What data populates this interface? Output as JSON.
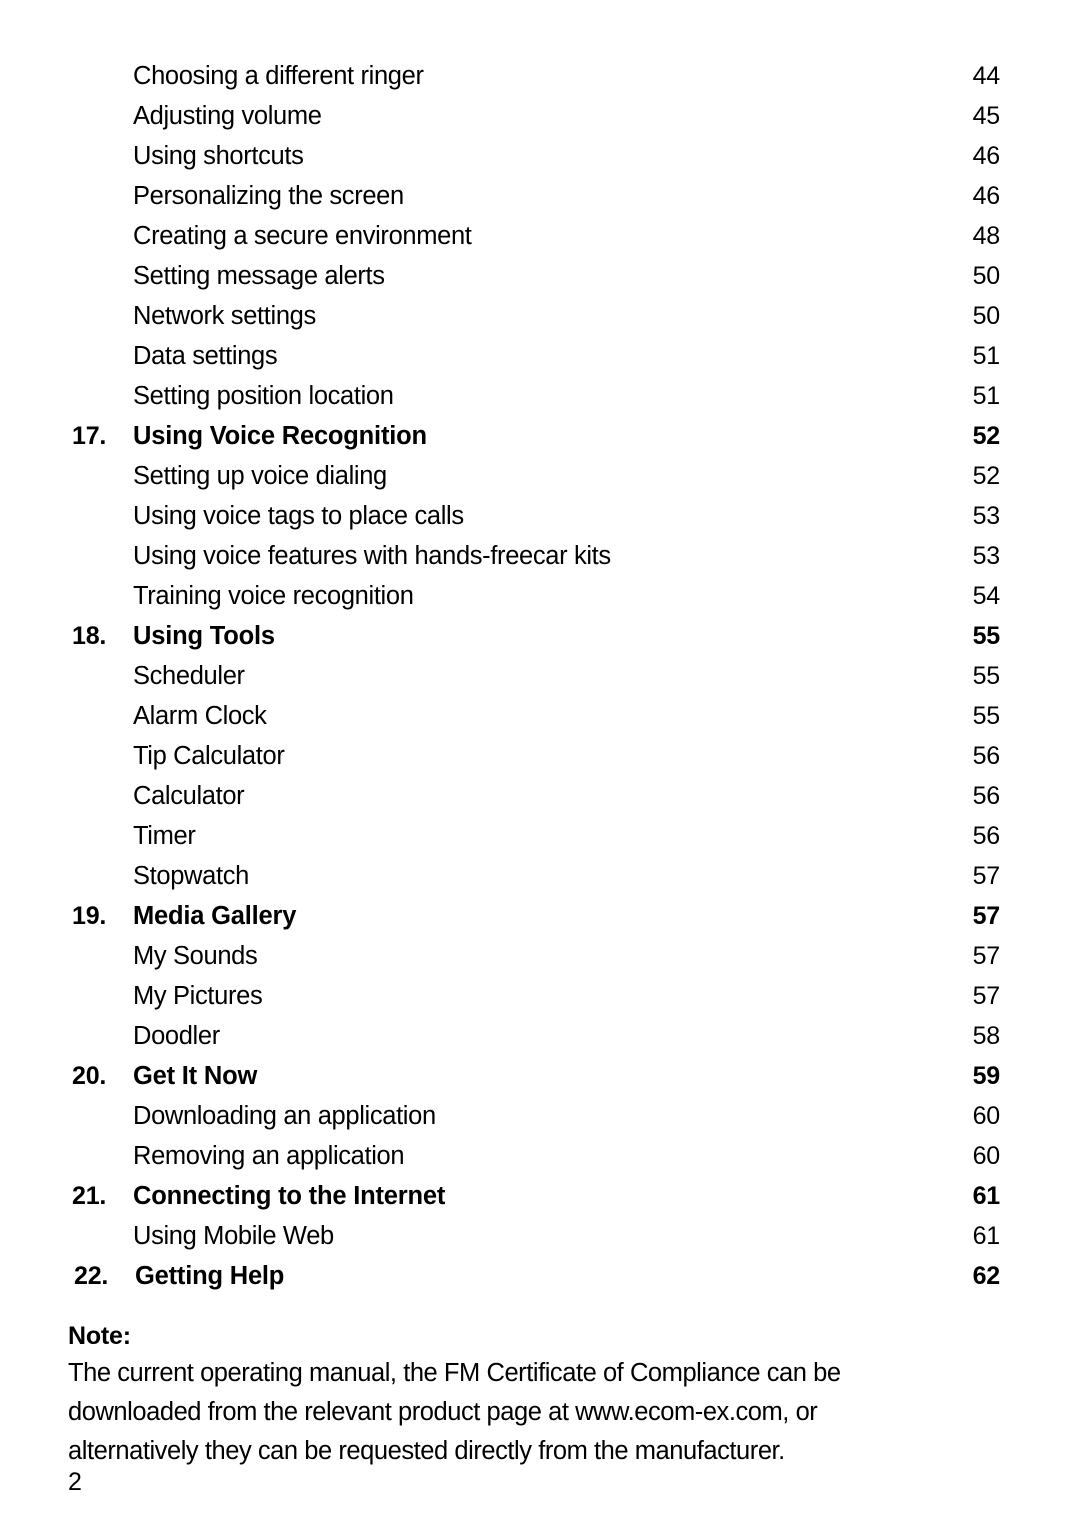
{
  "document": {
    "page_number": "2"
  },
  "toc": {
    "entries": [
      {
        "number": "",
        "title": "Choosing a different ringer",
        "page": "44",
        "level": "sub"
      },
      {
        "number": "",
        "title": "Adjusting volume",
        "page": "45",
        "level": "sub"
      },
      {
        "number": "",
        "title": "Using shortcuts",
        "page": "46",
        "level": "sub"
      },
      {
        "number": "",
        "title": "Personalizing the screen",
        "page": "46",
        "level": "sub"
      },
      {
        "number": "",
        "title": "Creating a secure environment",
        "page": "48",
        "level": "sub"
      },
      {
        "number": "",
        "title": "Setting message alerts",
        "page": "50",
        "level": "sub"
      },
      {
        "number": "",
        "title": "Network settings",
        "page": "50",
        "level": "sub"
      },
      {
        "number": "",
        "title": "Data settings",
        "page": "51",
        "level": "sub"
      },
      {
        "number": "",
        "title": "Setting position location",
        "page": "51",
        "level": "sub"
      },
      {
        "number": "17.",
        "title": "Using Voice Recognition",
        "page": "52",
        "level": "section"
      },
      {
        "number": "",
        "title": "Setting up voice dialing",
        "page": "52",
        "level": "sub"
      },
      {
        "number": "",
        "title": "Using voice tags to place calls",
        "page": "53",
        "level": "sub"
      },
      {
        "number": "",
        "title": "Using voice features with hands-freecar kits",
        "page": "53",
        "level": "sub"
      },
      {
        "number": "",
        "title": "Training voice recognition",
        "page": "54",
        "level": "sub"
      },
      {
        "number": "18.",
        "title": "Using Tools",
        "page": "55",
        "level": "section"
      },
      {
        "number": "",
        "title": "Scheduler",
        "page": "55",
        "level": "sub"
      },
      {
        "number": "",
        "title": "Alarm Clock",
        "page": "55",
        "level": "sub"
      },
      {
        "number": "",
        "title": "Tip Calculator",
        "page": "56",
        "level": "sub"
      },
      {
        "number": "",
        "title": "Calculator",
        "page": "56",
        "level": "sub"
      },
      {
        "number": "",
        "title": "Timer",
        "page": "56",
        "level": "sub"
      },
      {
        "number": "",
        "title": "Stopwatch",
        "page": "57",
        "level": "sub"
      },
      {
        "number": "19.",
        "title": "Media Gallery",
        "page": "57",
        "level": "section"
      },
      {
        "number": "",
        "title": "My Sounds",
        "page": "57",
        "level": "sub"
      },
      {
        "number": "",
        "title": "My Pictures",
        "page": "57",
        "level": "sub"
      },
      {
        "number": "",
        "title": "Doodler",
        "page": "58",
        "level": "sub"
      },
      {
        "number": "20.",
        "title": "Get It Now",
        "page": "59",
        "level": "section"
      },
      {
        "number": "",
        "title": "Downloading an application",
        "page": "60",
        "level": "sub"
      },
      {
        "number": "",
        "title": "Removing an application",
        "page": "60",
        "level": "sub"
      },
      {
        "number": "21.",
        "title": "Connecting to the Internet",
        "page": "61",
        "level": "section"
      },
      {
        "number": "",
        "title": "Using Mobile Web",
        "page": "61",
        "level": "sub"
      },
      {
        "number": "22.",
        "title": "Getting Help",
        "page": "62",
        "level": "section"
      }
    ]
  },
  "note": {
    "label": "Note:",
    "lines": [
      "The current operating manual, the FM Certificate of Compliance can be",
      "downloaded from the relevant product page at www.ecom-ex.com, or",
      "alternatively they can be requested directly from the manufacturer."
    ]
  }
}
